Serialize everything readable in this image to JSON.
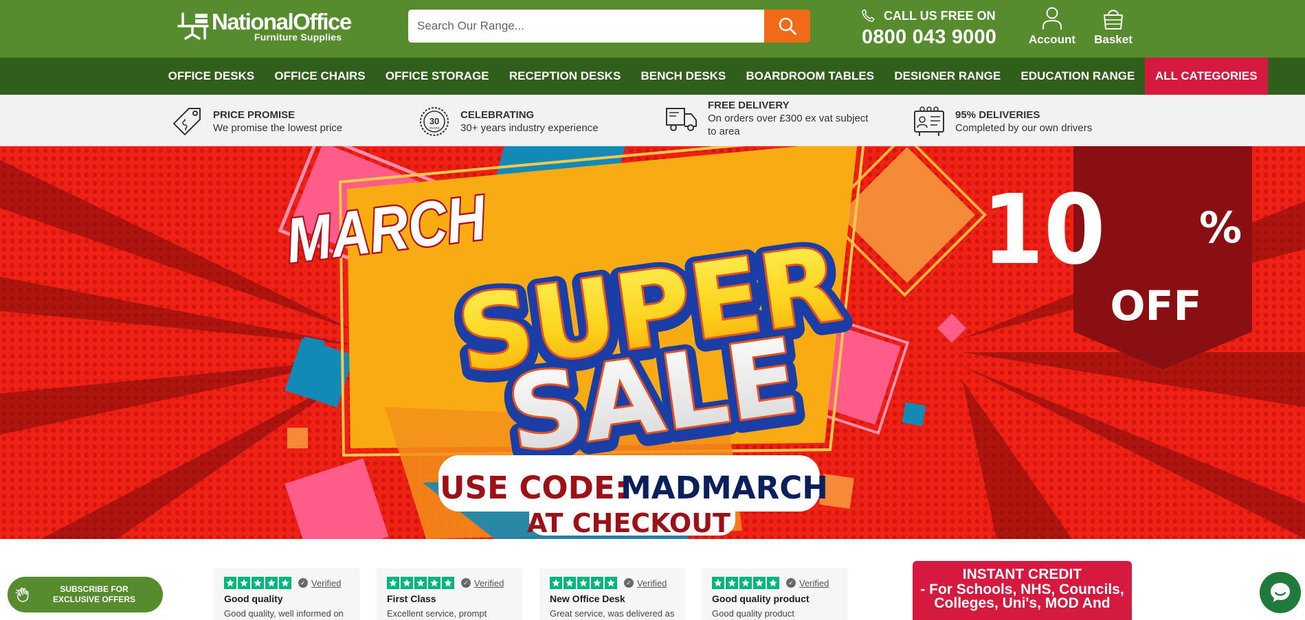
{
  "colors": {
    "header_green": "#568b2e",
    "nav_green": "#2f5f1b",
    "accent_red": "#d6193f",
    "search_orange": "#f06a18",
    "trustpilot_green": "#00b67a"
  },
  "header": {
    "logo": {
      "name": "NationalOffice",
      "tagline": "Furniture Supplies"
    },
    "search": {
      "placeholder": "Search Our Range...",
      "button_icon": "search-icon"
    },
    "phone": {
      "label": "CALL US FREE ON",
      "number": "0800 043 9000",
      "icon": "phone-icon"
    },
    "account": {
      "label": "Account",
      "icon": "user-icon"
    },
    "basket": {
      "label": "Basket",
      "icon": "basket-icon"
    }
  },
  "nav": {
    "items": [
      {
        "label": "OFFICE DESKS"
      },
      {
        "label": "OFFICE CHAIRS"
      },
      {
        "label": "OFFICE STORAGE"
      },
      {
        "label": "RECEPTION DESKS"
      },
      {
        "label": "BENCH DESKS"
      },
      {
        "label": "BOARDROOM TABLES"
      },
      {
        "label": "DESIGNER RANGE"
      },
      {
        "label": "EDUCATION RANGE"
      },
      {
        "label": "ALL CATEGORIES"
      }
    ]
  },
  "usps": [
    {
      "title": "PRICE PROMISE",
      "text": "We promise the lowest price",
      "icon": "price-tag-icon"
    },
    {
      "title": "CELEBRATING",
      "text": "30+ years industry experience",
      "icon": "thirty-years-badge-icon",
      "badge": "30",
      "badge_sub": "YEARS"
    },
    {
      "title": "FREE DELIVERY",
      "text": "On orders over £300 ex vat subject to area",
      "icon": "delivery-truck-icon"
    },
    {
      "title": "95% DELIVERIES",
      "text": "Completed by our own drivers",
      "icon": "delivery-driver-icon"
    }
  ],
  "hero": {
    "line1": "MARCH",
    "line2": "SUPER",
    "line3": "SALE",
    "code_label": "USE CODE:",
    "code": "MADMARCH",
    "code_suffix": "AT CHECKOUT",
    "discount": "10",
    "percent": "%",
    "off": "OFF"
  },
  "reviews": [
    {
      "title": "Good quality",
      "body": "Good quality, well informed on",
      "verified": "Verified",
      "stars": 5
    },
    {
      "title": "First Class",
      "body": "Excellent service, prompt",
      "verified": "Verified",
      "stars": 5
    },
    {
      "title": "New Office Desk",
      "body": "Great service, was delivered as",
      "verified": "Verified",
      "stars": 5
    },
    {
      "title": "Good quality product",
      "body": "Good quality product",
      "verified": "Verified",
      "stars": 5
    }
  ],
  "credit": {
    "heading": "INSTANT CREDIT",
    "line1": "- For Schools, NHS, Councils,",
    "line2": "Colleges, Uni's, MOD And"
  },
  "subscribe": {
    "line1": "SUBSCRIBE FOR",
    "line2": "EXCLUSIVE OFFERS",
    "icon": "hand-wave-icon"
  },
  "chat": {
    "icon": "chat-icon"
  }
}
